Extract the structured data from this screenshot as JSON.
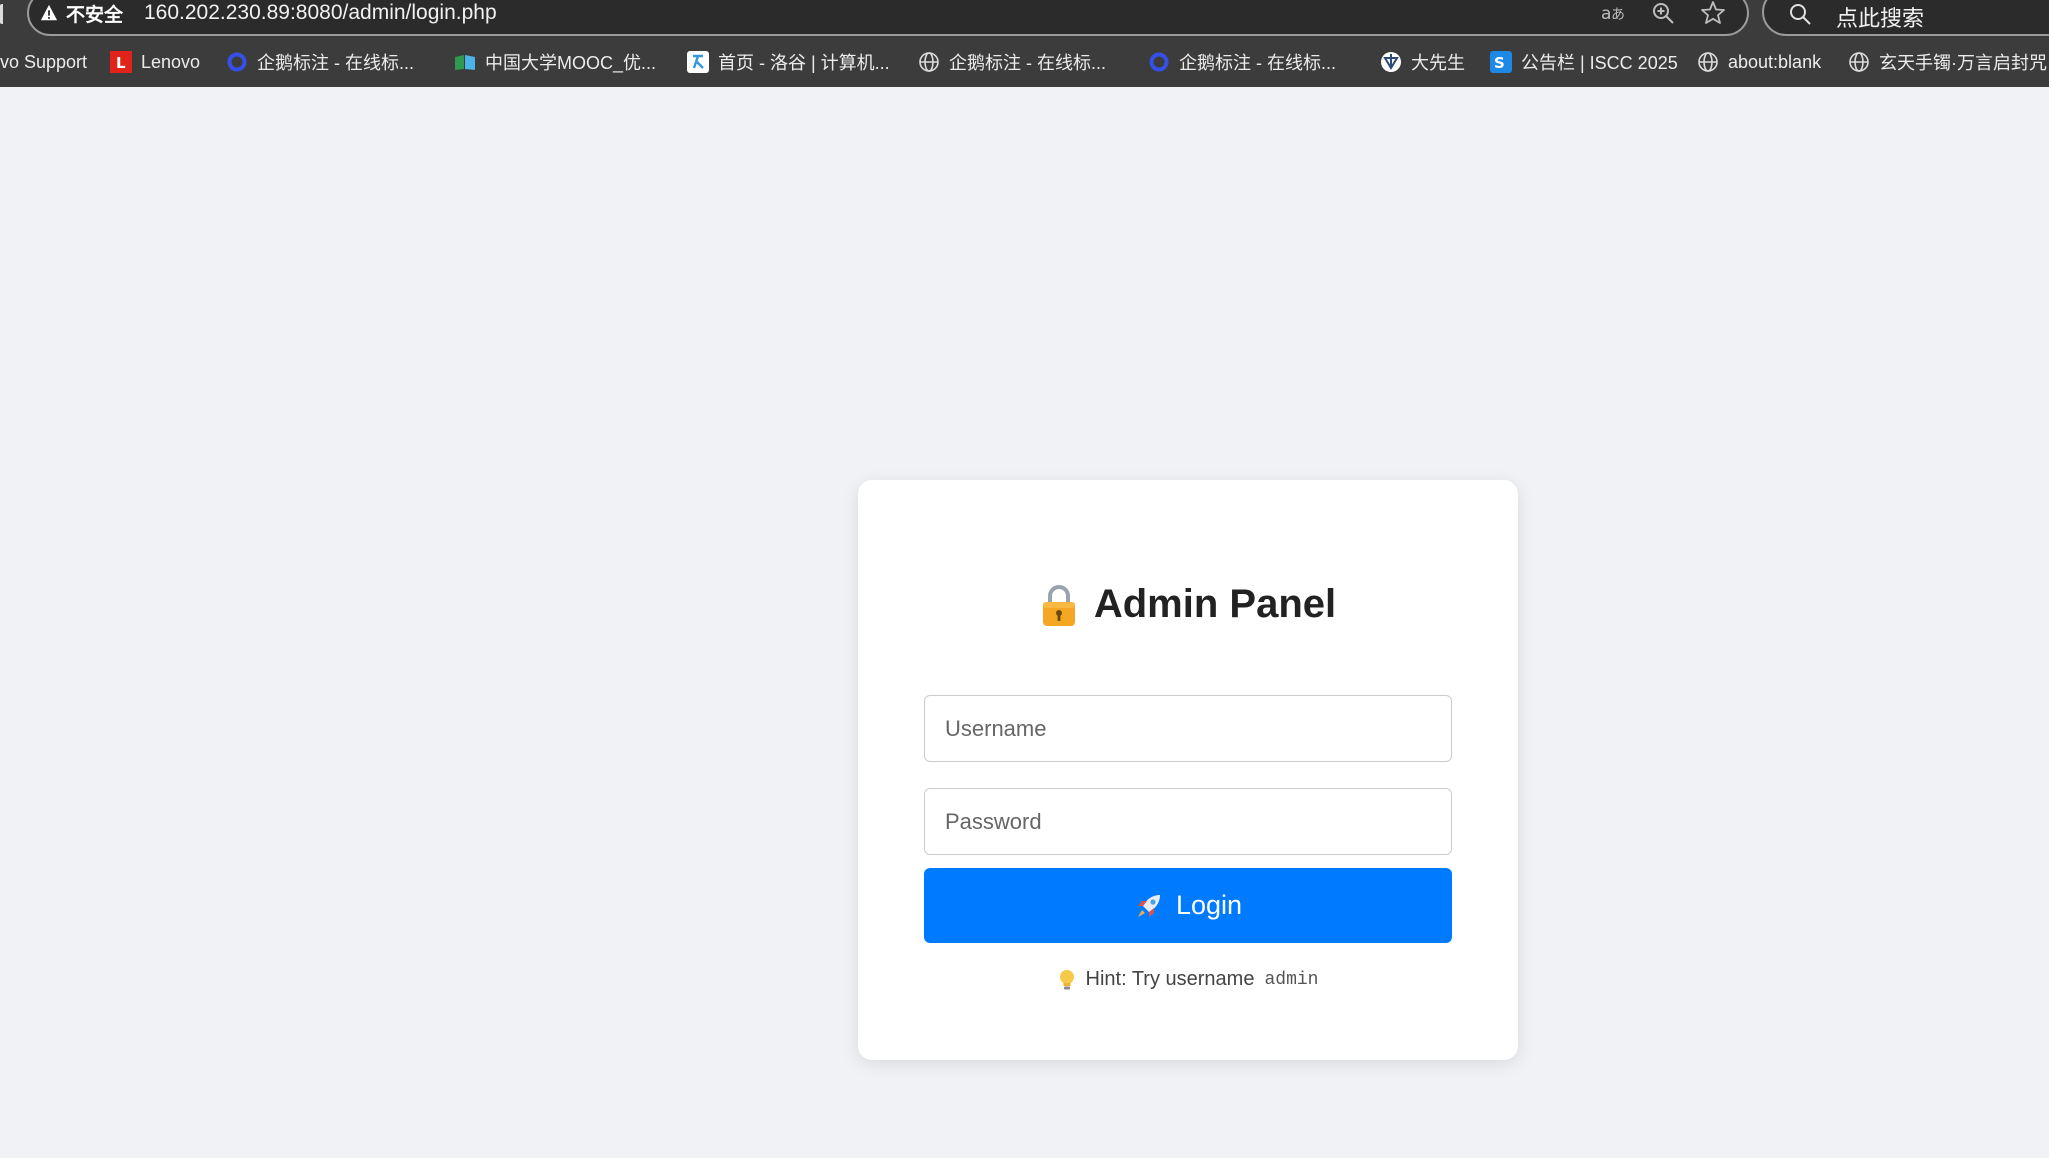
{
  "browser": {
    "security_label": "不安全",
    "url": "160.202.230.89:8080/admin/login.php",
    "search_placeholder": "点此搜索",
    "icons": [
      "warning-icon",
      "translate-icon",
      "zoom-icon",
      "star-icon",
      "search-icon"
    ]
  },
  "bookmarks": [
    {
      "label": "vo Support",
      "icon": "none"
    },
    {
      "label": "Lenovo",
      "icon": "lenovo-icon"
    },
    {
      "label": "企鹅标注 - 在线标...",
      "icon": "ring-icon"
    },
    {
      "label": "中国大学MOOC_优...",
      "icon": "mooc-icon"
    },
    {
      "label": "首页 - 洛谷 | 计算机...",
      "icon": "luogu-icon"
    },
    {
      "label": "企鹅标注 - 在线标...",
      "icon": "globe-icon"
    },
    {
      "label": "企鹅标注 - 在线标...",
      "icon": "ring-icon"
    },
    {
      "label": "大先生",
      "icon": "dxs-icon"
    },
    {
      "label": "公告栏 | ISCC 2025",
      "icon": "iscc-icon"
    },
    {
      "label": "about:blank",
      "icon": "globe-icon"
    },
    {
      "label": "玄天手镯·万言启封咒",
      "icon": "globe-icon"
    }
  ],
  "login": {
    "title": "Admin Panel",
    "title_icon": "lock-icon",
    "username_placeholder": "Username",
    "username_value": "",
    "password_placeholder": "Password",
    "password_value": "",
    "button_label": "Login",
    "button_icon": "rocket-icon",
    "hint_text": "Hint: Try username",
    "hint_code": "admin",
    "hint_icon": "lightbulb-icon"
  },
  "colors": {
    "page_bg": "#f0f2f5",
    "card_bg": "#ffffff",
    "button_bg": "#007bff",
    "chrome_bg": "#3c3c3c"
  }
}
